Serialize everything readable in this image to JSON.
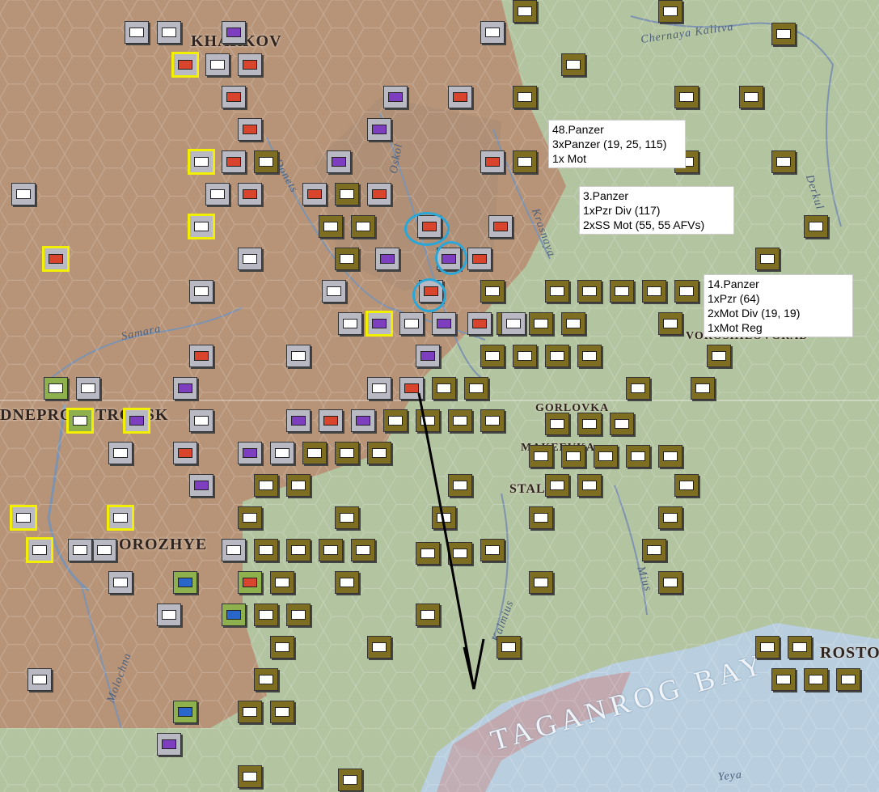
{
  "map": {
    "cities": [
      {
        "name": "KHARKOV"
      },
      {
        "name": "DNEPROPETROVSK"
      },
      {
        "name": "ZAPOROZHYE"
      },
      {
        "name": "GORLOVKA"
      },
      {
        "name": "MAKEEVKA"
      },
      {
        "name": "STALINO"
      },
      {
        "name": "VOROSHILOVGRAD"
      },
      {
        "name": "ROSTOV"
      }
    ],
    "rivers": [
      {
        "name": "Chernaya Kalitva"
      },
      {
        "name": "Derkul"
      },
      {
        "name": "Oskol"
      },
      {
        "name": "Donets"
      },
      {
        "name": "Krasnaya"
      },
      {
        "name": "Samara"
      },
      {
        "name": "Kalmius"
      },
      {
        "name": "Mius"
      },
      {
        "name": "Molochna"
      },
      {
        "name": "Yeya"
      }
    ],
    "bay": "TAGANROG BAY"
  },
  "info_boxes": [
    {
      "lines": [
        "48.Panzer",
        "3xPanzer (19, 25, 115)",
        "1x Mot"
      ]
    },
    {
      "lines": [
        "3.Panzer",
        "1xPzr Div (117)",
        "2xSS Mot (55, 55 AFVs)"
      ]
    },
    {
      "lines": [
        "14.Panzer",
        "1xPzr (64)",
        "2xMot Div (19, 19)",
        "1xMot Reg"
      ]
    }
  ],
  "colors": {
    "steppe": "#b79478",
    "grassland": "#b3c4a1",
    "water": "#b9cfe0",
    "german_counter": "#7e6e22",
    "axis_counter": "#b9b9c4",
    "ally_counter": "#8fb14d",
    "selection_ring": "#2aa7d8",
    "highlight": "#f2f000"
  }
}
